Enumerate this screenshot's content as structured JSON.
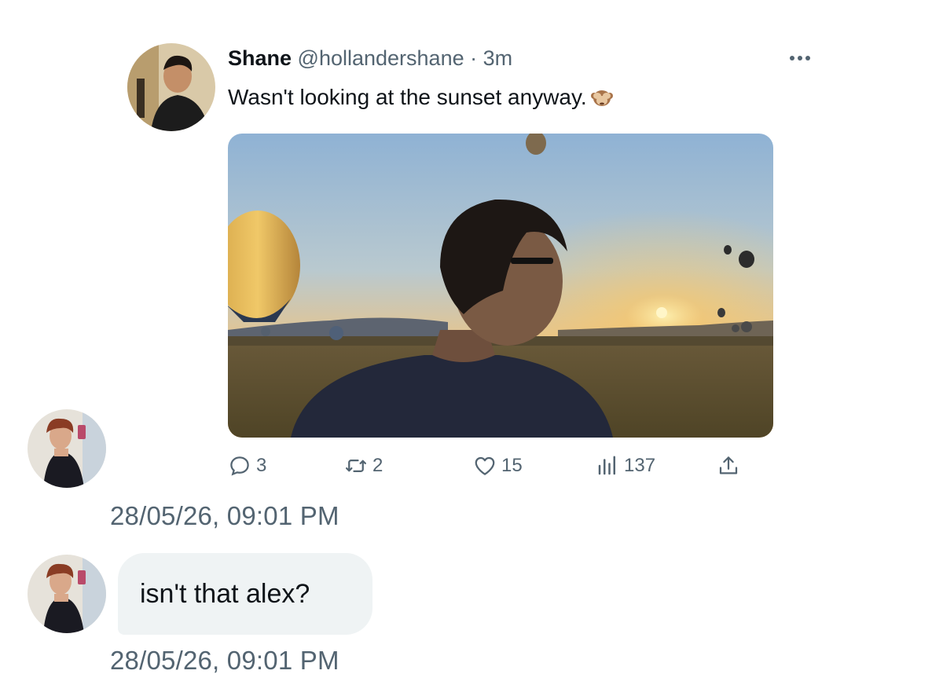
{
  "tweet": {
    "author_name": "Shane",
    "handle": "@hollandershane",
    "separator": "·",
    "time_ago": "3m",
    "text": "Wasn't looking at the sunset anyway.",
    "emoji": "see-no-evil-monkey",
    "more_icon": "more-horizontal-icon",
    "media_description_icon": "photo",
    "stats": {
      "replies": "3",
      "retweets": "2",
      "likes": "15",
      "views": "137"
    }
  },
  "dm": {
    "share_timestamp": "28/05/26, 09:01 PM",
    "message_text": "isn't that alex?",
    "message_timestamp": "28/05/26, 09:01 PM"
  },
  "colors": {
    "text_primary": "#0f1419",
    "text_secondary": "#536471",
    "bubble_bg": "#eff3f4",
    "background": "#ffffff"
  }
}
